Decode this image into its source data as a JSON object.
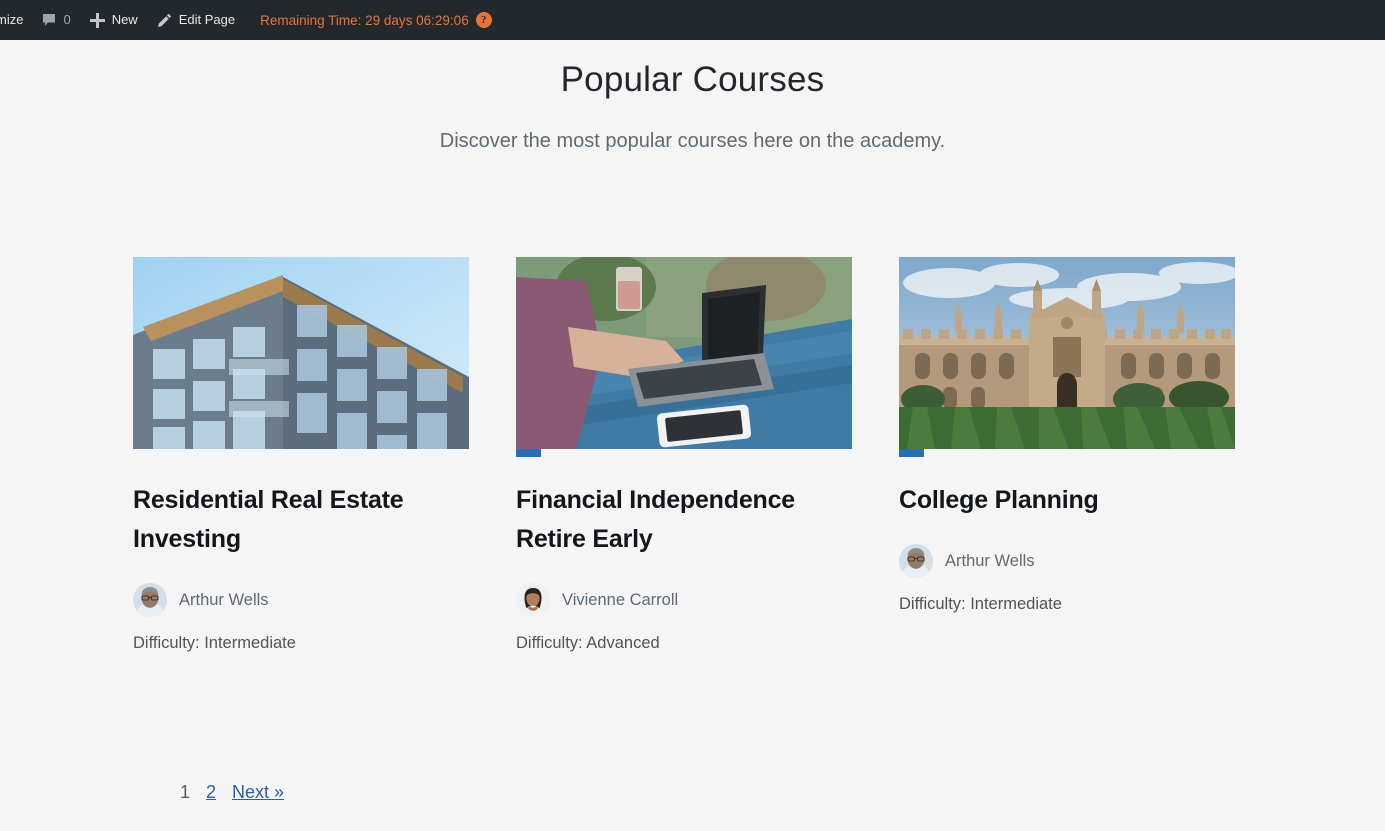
{
  "adminbar": {
    "customize_label": "mize",
    "comments_icon": "comment-bubble-icon",
    "comments_count": "0",
    "new_icon": "plus-icon",
    "new_label": "New",
    "edit_icon": "pencil-icon",
    "edit_label": "Edit Page",
    "remaining_time": "Remaining Time: 29 days 06:29:06",
    "help_badge": "?",
    "accent_color": "#e8743b",
    "background_color": "#23282d"
  },
  "page": {
    "title": "Popular Courses",
    "subtitle": "Discover the most popular courses here on the academy.",
    "background_color": "#f5f5f5"
  },
  "courses": [
    {
      "title": "Residential Real Estate Investing",
      "author": "Arthur Wells",
      "difficulty": "Difficulty: Intermediate",
      "thumbnail": "apartment-building-photo",
      "has_progress": false,
      "progress_percent": 0
    },
    {
      "title": "Financial Independence Retire Early",
      "author": "Vivienne Carroll",
      "difficulty": "Difficulty: Advanced",
      "thumbnail": "person-typing-on-laptop-photo",
      "has_progress": true,
      "progress_percent": 7
    },
    {
      "title": "College Planning",
      "author": "Arthur Wells",
      "difficulty": "Difficulty: Intermediate",
      "thumbnail": "college-campus-building-photo",
      "has_progress": true,
      "progress_percent": 7
    }
  ],
  "pagination": {
    "current": "1",
    "next_page": "2",
    "next_label": "Next »",
    "link_color": "#2a5db0"
  }
}
